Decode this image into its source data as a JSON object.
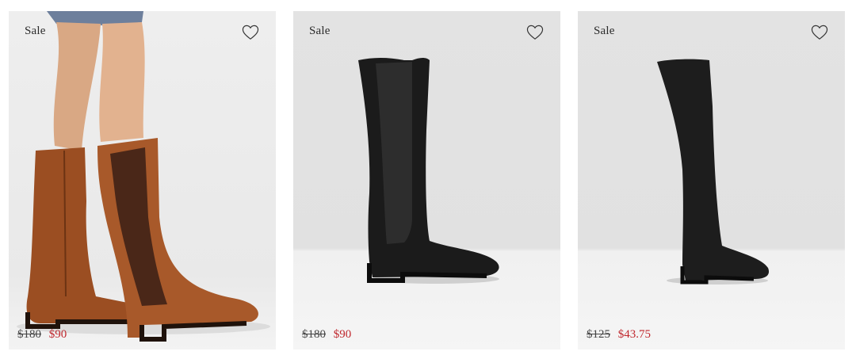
{
  "products": [
    {
      "badge": "Sale",
      "original_price": "$180",
      "sale_price": "$90",
      "image": "tan-leather-knee-high-boots-on-model",
      "wishlist_icon": "heart-outline-icon"
    },
    {
      "badge": "Sale",
      "original_price": "$180",
      "sale_price": "$90",
      "image": "black-leather-knee-high-chelsea-boot",
      "wishlist_icon": "heart-outline-icon"
    },
    {
      "badge": "Sale",
      "original_price": "$125",
      "sale_price": "$43.75",
      "image": "black-over-the-knee-boot",
      "wishlist_icon": "heart-outline-icon"
    }
  ],
  "colors": {
    "sale_price": "#c0272d",
    "card_background": "#e3e3e3"
  }
}
